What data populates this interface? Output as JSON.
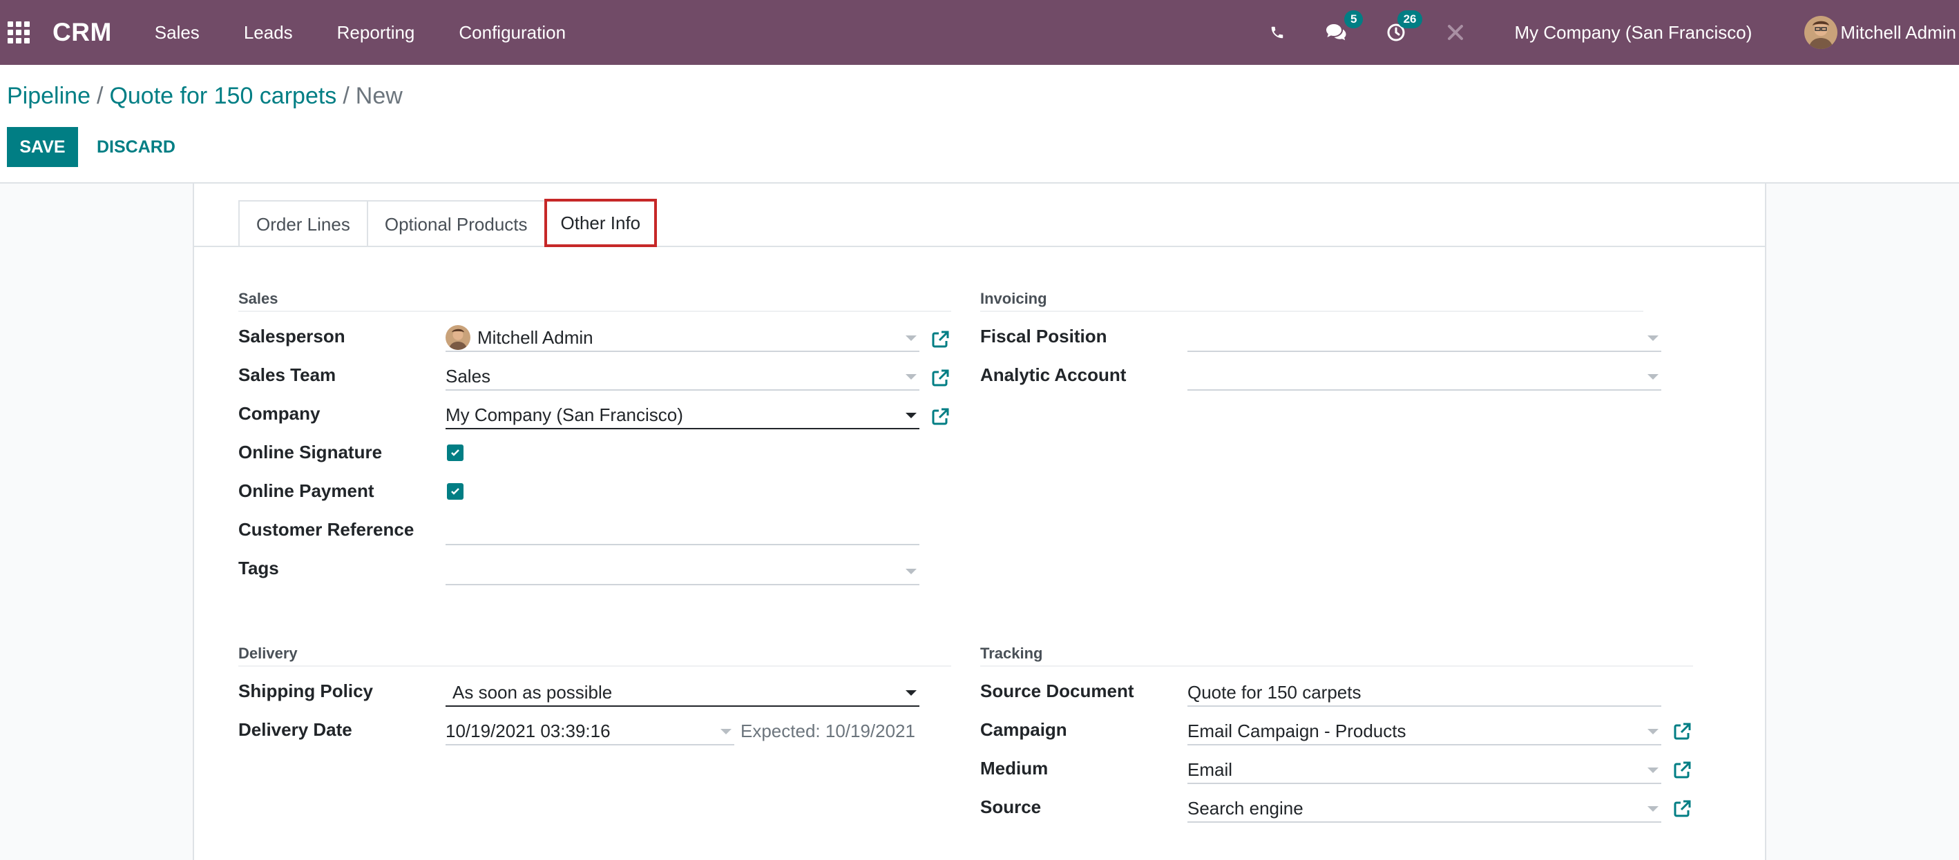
{
  "navbar": {
    "brand": "CRM",
    "menu": [
      "Sales",
      "Leads",
      "Reporting",
      "Configuration"
    ],
    "messages_count": "5",
    "activities_count": "26",
    "company": "My Company (San Francisco)",
    "user": "Mitchell Admin",
    "accent": "#714b67"
  },
  "breadcrumb": {
    "items": [
      "Pipeline",
      "Quote for 150 carpets"
    ],
    "current": "New"
  },
  "buttons": {
    "save": "SAVE",
    "discard": "DISCARD"
  },
  "tabs": [
    "Order Lines",
    "Optional Products",
    "Other Info"
  ],
  "active_tab": "Other Info",
  "sales": {
    "title": "Sales",
    "salesperson_label": "Salesperson",
    "salesperson": "Mitchell Admin",
    "team_label": "Sales Team",
    "team": "Sales",
    "company_label": "Company",
    "company": "My Company (San Francisco)",
    "online_signature_label": "Online Signature",
    "online_signature": true,
    "online_payment_label": "Online Payment",
    "online_payment": true,
    "customer_reference_label": "Customer Reference",
    "customer_reference": "",
    "tags_label": "Tags",
    "tags": ""
  },
  "invoicing": {
    "title": "Invoicing",
    "fiscal_position_label": "Fiscal Position",
    "fiscal_position": "",
    "analytic_account_label": "Analytic Account",
    "analytic_account": ""
  },
  "delivery": {
    "title": "Delivery",
    "shipping_policy_label": "Shipping Policy",
    "shipping_policy": "As soon as possible",
    "delivery_date_label": "Delivery Date",
    "delivery_date": "10/19/2021 03:39:16",
    "expected": "Expected: 10/19/2021"
  },
  "tracking": {
    "title": "Tracking",
    "source_document_label": "Source Document",
    "source_document": "Quote for 150 carpets",
    "campaign_label": "Campaign",
    "campaign": "Email Campaign - Products",
    "medium_label": "Medium",
    "medium": "Email",
    "source_label": "Source",
    "source": "Search engine"
  },
  "colors": {
    "primary": "#017e84",
    "highlight": "#c62828"
  }
}
